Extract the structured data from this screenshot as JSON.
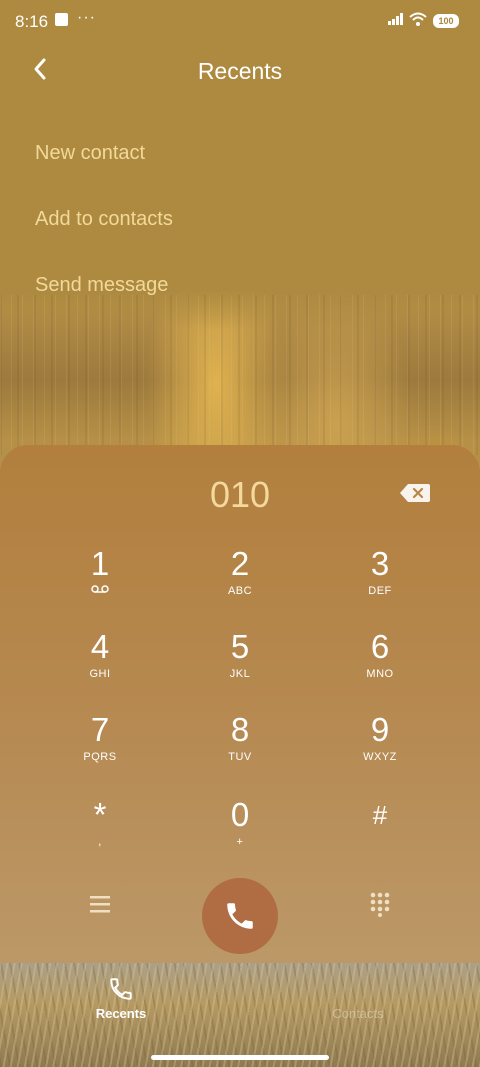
{
  "status_bar": {
    "time": "8:16",
    "more": "···",
    "battery": "100"
  },
  "header": {
    "title": "Recents"
  },
  "menu": [
    "New contact",
    "Add to contacts",
    "Send message"
  ],
  "dialer": {
    "number": "010",
    "keys": [
      {
        "digit": "1",
        "letters": ""
      },
      {
        "digit": "2",
        "letters": "ABC"
      },
      {
        "digit": "3",
        "letters": "DEF"
      },
      {
        "digit": "4",
        "letters": "GHI"
      },
      {
        "digit": "5",
        "letters": "JKL"
      },
      {
        "digit": "6",
        "letters": "MNO"
      },
      {
        "digit": "7",
        "letters": "PQRS"
      },
      {
        "digit": "8",
        "letters": "TUV"
      },
      {
        "digit": "9",
        "letters": "WXYZ"
      },
      {
        "digit": "*",
        "letters": ","
      },
      {
        "digit": "0",
        "letters": "+"
      },
      {
        "digit": "#",
        "letters": ""
      }
    ]
  },
  "nav": {
    "recents": "Recents",
    "contacts": "Contacts"
  },
  "colors": {
    "accent_text": "#f2d99a",
    "call_button": "#b06d43"
  }
}
